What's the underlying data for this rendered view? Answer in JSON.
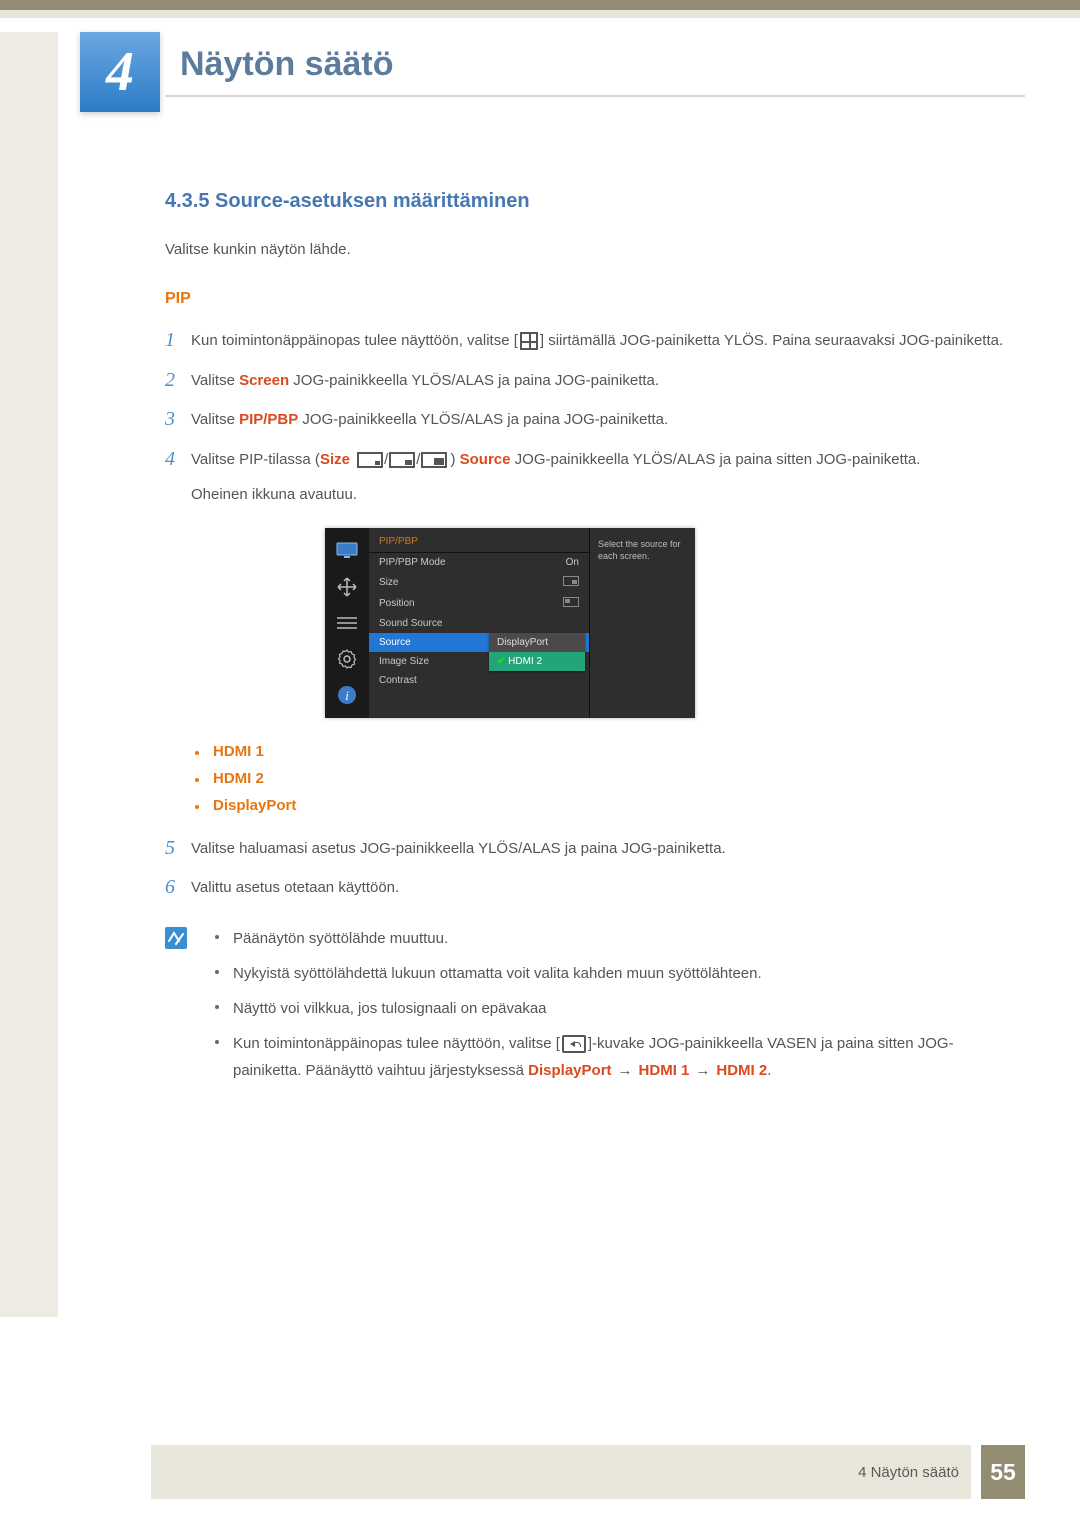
{
  "chapter": {
    "number": "4",
    "title": "Näytön säätö"
  },
  "section": {
    "heading": "4.3.5   Source-asetuksen määrittäminen",
    "intro": "Valitse kunkin näytön lähde.",
    "pip_heading": "PIP"
  },
  "steps": {
    "s1": {
      "num": "1",
      "a": "Kun toimintonäppäinopas tulee näyttöön, valitse [",
      "b": "] siirtämällä JOG-painiketta YLÖS. Paina seuraavaksi JOG-painiketta."
    },
    "s2": {
      "num": "2",
      "a": "Valitse ",
      "screen": "Screen",
      "b": " JOG-painikkeella YLÖS/ALAS ja paina JOG-painiketta."
    },
    "s3": {
      "num": "3",
      "a": "Valitse ",
      "pippbp": "PIP/PBP",
      "b": " JOG-painikkeella YLÖS/ALAS ja paina JOG-painiketta."
    },
    "s4": {
      "num": "4",
      "a": "Valitse PIP-tilassa (",
      "size": "Size",
      "b": ") ",
      "source": "Source",
      "c": " JOG-painikkeella YLÖS/ALAS ja paina sitten JOG-painiketta.",
      "d": "Oheinen ikkuna avautuu."
    },
    "s5": {
      "num": "5",
      "text": "Valitse haluamasi asetus JOG-painikkeella YLÖS/ALAS ja paina JOG-painiketta."
    },
    "s6": {
      "num": "6",
      "text": "Valittu asetus otetaan käyttöön."
    }
  },
  "osd": {
    "title": "PIP/PBP",
    "rows": {
      "mode": {
        "label": "PIP/PBP Mode",
        "value": "On"
      },
      "size": {
        "label": "Size"
      },
      "position": {
        "label": "Position"
      },
      "soundsource": {
        "label": "Sound Source"
      },
      "source": {
        "label": "Source"
      },
      "imagesize": {
        "label": "Image Size"
      },
      "contrast": {
        "label": "Contrast"
      }
    },
    "dropdown": {
      "item1": "DisplayPort",
      "item2": "HDMI 2"
    },
    "help": "Select the source for each screen."
  },
  "source_opts": {
    "o1": "HDMI 1",
    "o2": "HDMI 2",
    "o3": "DisplayPort"
  },
  "notes": {
    "n1": "Päänäytön syöttölähde muuttuu.",
    "n2": "Nykyistä syöttölähdettä lukuun ottamatta voit valita kahden muun syöttölähteen.",
    "n3": "Näyttö voi vilkkua, jos tulosignaali on epävakaa",
    "n4a": "Kun toimintonäppäinopas tulee näyttöön, valitse [",
    "n4b": "]-kuvake JOG-painikkeella VASEN ja paina sitten JOG-painiketta. Päänäyttö vaihtuu järjestyksessä ",
    "seq1": "DisplayPort",
    "seq2": "HDMI 1",
    "seq3": "HDMI 2",
    "dot": "."
  },
  "footer": {
    "text": "4  Näytön säätö",
    "page": "55"
  }
}
